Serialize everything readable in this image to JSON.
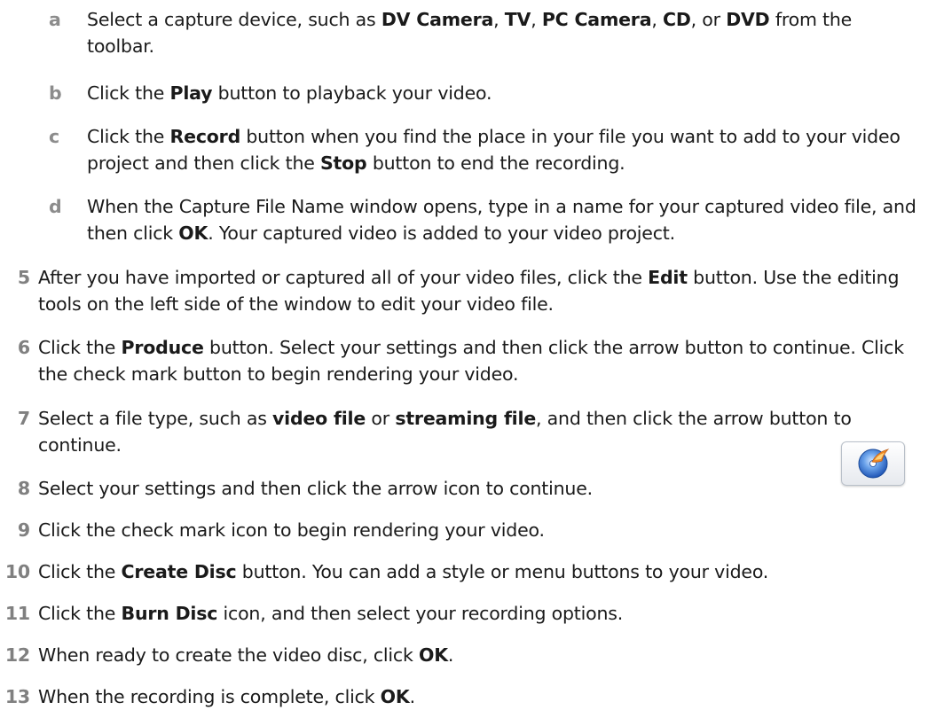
{
  "substeps": [
    {
      "id": "a",
      "label": "a",
      "segments": [
        {
          "t": "Select a capture device, such as "
        },
        {
          "t": "DV Camera",
          "b": true
        },
        {
          "t": ", "
        },
        {
          "t": "TV",
          "b": true
        },
        {
          "t": ", "
        },
        {
          "t": "PC Camera",
          "b": true
        },
        {
          "t": ", "
        },
        {
          "t": "CD",
          "b": true
        },
        {
          "t": ", or "
        },
        {
          "t": "DVD",
          "b": true
        },
        {
          "t": " from the toolbar."
        }
      ]
    },
    {
      "id": "b",
      "label": "b",
      "segments": [
        {
          "t": "Click the "
        },
        {
          "t": "Play",
          "b": true
        },
        {
          "t": " button to playback your video."
        }
      ]
    },
    {
      "id": "c",
      "label": "c",
      "segments": [
        {
          "t": "Click the "
        },
        {
          "t": "Record",
          "b": true
        },
        {
          "t": " button when you find the place in your file you want to add to your video project and then click the "
        },
        {
          "t": "Stop",
          "b": true
        },
        {
          "t": " button to end the recording."
        }
      ]
    },
    {
      "id": "d",
      "label": "d",
      "segments": [
        {
          "t": "When the Capture File Name window opens, type in a name for your captured video file, and then click "
        },
        {
          "t": "OK",
          "b": true
        },
        {
          "t": ". Your captured video is added to your video project."
        }
      ]
    }
  ],
  "steps": [
    {
      "id": "5",
      "label": "5",
      "segments": [
        {
          "t": "After you have imported or captured all of your video files, click the "
        },
        {
          "t": "Edit",
          "b": true
        },
        {
          "t": " button. Use the editing tools on the left side of the window to edit your video file."
        }
      ]
    },
    {
      "id": "6",
      "label": "6",
      "segments": [
        {
          "t": "Click the "
        },
        {
          "t": "Produce",
          "b": true
        },
        {
          "t": " button. Select your settings and then click the arrow button to continue. Click the check mark button to begin rendering your video."
        }
      ]
    },
    {
      "id": "7",
      "label": "7",
      "segments": [
        {
          "t": "Select a file type, such as "
        },
        {
          "t": "video file",
          "b": true
        },
        {
          "t": " or "
        },
        {
          "t": "streaming file",
          "b": true
        },
        {
          "t": ", and then click the arrow button to continue."
        }
      ]
    },
    {
      "id": "8",
      "label": "8",
      "segments": [
        {
          "t": "Select your settings and then click the arrow icon to continue."
        }
      ]
    },
    {
      "id": "9",
      "label": "9",
      "segments": [
        {
          "t": "Click the check mark icon to begin rendering your video."
        }
      ]
    },
    {
      "id": "10",
      "label": "10",
      "segments": [
        {
          "t": "Click the "
        },
        {
          "t": "Create Disc",
          "b": true
        },
        {
          "t": " button. You can add a style or menu buttons to your video."
        }
      ]
    },
    {
      "id": "11",
      "label": "11",
      "segments": [
        {
          "t": "Click the "
        },
        {
          "t": "Burn Disc",
          "b": true
        },
        {
          "t": " icon, and then select your recording options."
        }
      ]
    },
    {
      "id": "12",
      "label": "12",
      "segments": [
        {
          "t": "When ready to create the video disc, click "
        },
        {
          "t": "OK",
          "b": true
        },
        {
          "t": "."
        }
      ]
    },
    {
      "id": "13",
      "label": "13",
      "segments": [
        {
          "t": "When the recording is complete, click "
        },
        {
          "t": "OK",
          "b": true
        },
        {
          "t": "."
        }
      ]
    }
  ],
  "burn_disc_icon": {
    "name": "burn-disc-icon",
    "accent": "#2f6fd6",
    "flame": "#f08a24"
  }
}
